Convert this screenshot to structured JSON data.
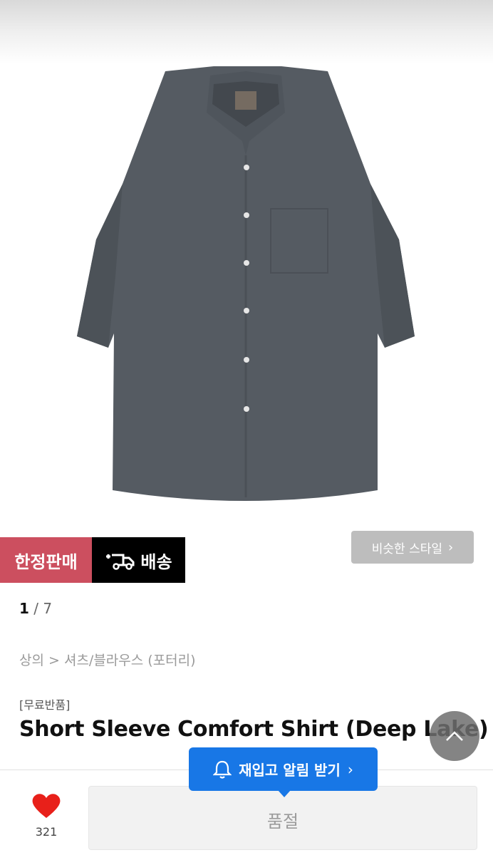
{
  "badges": {
    "limited_label": "한정판매",
    "delivery_label": "배송",
    "delivery_icon": "truck-plus-icon",
    "limited_color": "#cc4f5f",
    "delivery_color": "#000000"
  },
  "similar_style": {
    "label": "비슷한 스타일",
    "chevron": "›"
  },
  "pager": {
    "current": "1",
    "separator": " / ",
    "total": "7"
  },
  "breadcrumb": "상의 > 셔츠/블라우스 (포터리)",
  "product": {
    "tag": "[무료반품]",
    "title": "Short Sleeve Comfort Shirt (Deep Lake)",
    "image_icon": "shirt-image"
  },
  "like": {
    "icon": "heart-icon",
    "count": "321",
    "color": "#e8201a"
  },
  "restock": {
    "label": "재입고 알림 받기",
    "chevron": "›",
    "icon": "bell-icon",
    "color": "#1877e6"
  },
  "purchase": {
    "label": "품절"
  },
  "scroll_top": {
    "icon": "chevron-up-icon"
  }
}
